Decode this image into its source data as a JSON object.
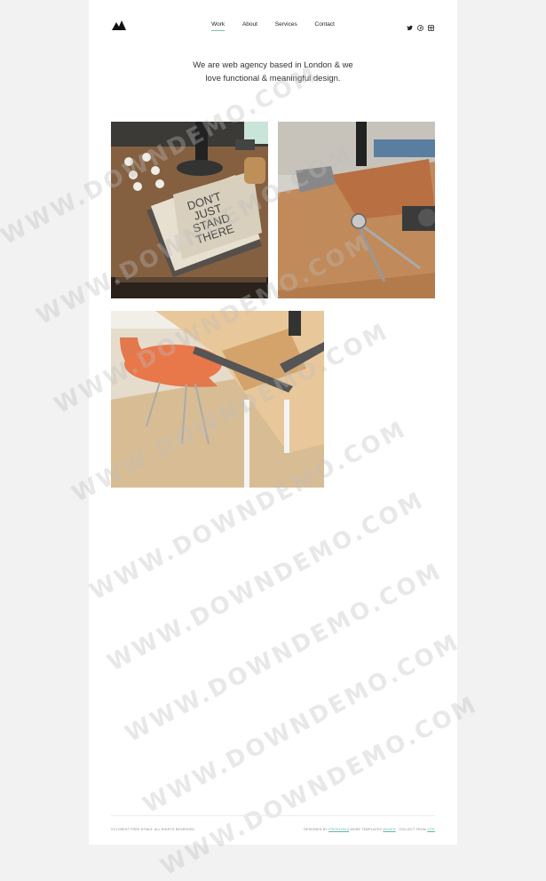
{
  "nav": {
    "items": [
      {
        "label": "Work",
        "active": true
      },
      {
        "label": "About",
        "active": false
      },
      {
        "label": "Services",
        "active": false
      },
      {
        "label": "Contact",
        "active": false
      }
    ]
  },
  "social": [
    "twitter-icon",
    "pinterest-icon",
    "instagram-icon"
  ],
  "intro": {
    "line1": "We are web agency based in London & we",
    "line2": "love functional & meaningful design."
  },
  "gallery": {
    "tile1_text": "DON'T JUST STAND THERE"
  },
  "footer": {
    "left": "©CLOSEST FREE HTML5. ALL RIGHTS RESERVED",
    "right_prefix": "DESIGNED BY",
    "right_link1": "FREEHTML5",
    "right_mid": " MORE TEMPLATES",
    "right_link2": "MUGEN",
    "right_mid2": " - COLLECT FROM",
    "right_link3": "SITE"
  },
  "watermark": "WWW.DOWNDEMO.COM",
  "colors": {
    "accent": "#7fbfb0",
    "background": "#f2f2f2",
    "page": "#ffffff"
  }
}
